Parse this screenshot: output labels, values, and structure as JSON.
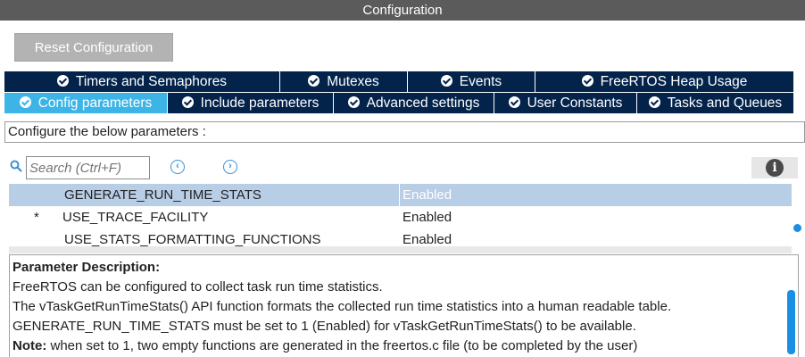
{
  "window": {
    "title": "Configuration"
  },
  "toolbar": {
    "reset_label": "Reset Configuration"
  },
  "tabs": {
    "row1": [
      {
        "label": "Timers and Semaphores"
      },
      {
        "label": "Mutexes"
      },
      {
        "label": "Events"
      },
      {
        "label": "FreeRTOS Heap Usage"
      }
    ],
    "row2": [
      {
        "label": "Config parameters",
        "active": true
      },
      {
        "label": "Include parameters"
      },
      {
        "label": "Advanced settings"
      },
      {
        "label": "User Constants"
      },
      {
        "label": "Tasks and Queues"
      }
    ]
  },
  "config_header": "Configure the below parameters :",
  "search": {
    "placeholder": "Search (Ctrl+F)",
    "prev_icon": "chevron-left-icon",
    "next_icon": "chevron-right-icon"
  },
  "info_icon": "info-icon",
  "parameters": [
    {
      "marker": "",
      "name": "GENERATE_RUN_TIME_STATS",
      "value": "Enabled",
      "selected": true
    },
    {
      "marker": "*",
      "name": "USE_TRACE_FACILITY",
      "value": "Enabled"
    },
    {
      "marker": "",
      "name": "USE_STATS_FORMATTING_FUNCTIONS",
      "value": "Enabled"
    }
  ],
  "description": {
    "heading": "Parameter Description:",
    "lines": [
      "FreeRTOS can be configured to collect task run time statistics.",
      "The vTaskGetRunTimeStats() API function formats the collected run time statistics into a human readable table.",
      "GENERATE_RUN_TIME_STATS must be set to 1 (Enabled) for vTaskGetRunTimeStats() to be available."
    ],
    "note_label": "Note:",
    "note_text": " when set to 1, two empty functions are generated in the freertos.c file (to be completed by the user)"
  },
  "colors": {
    "tab_bg": "#03234b",
    "tab_active": "#3cb4e6",
    "title_bar": "#5b5b5b",
    "selected_row": "#b8cde6"
  }
}
